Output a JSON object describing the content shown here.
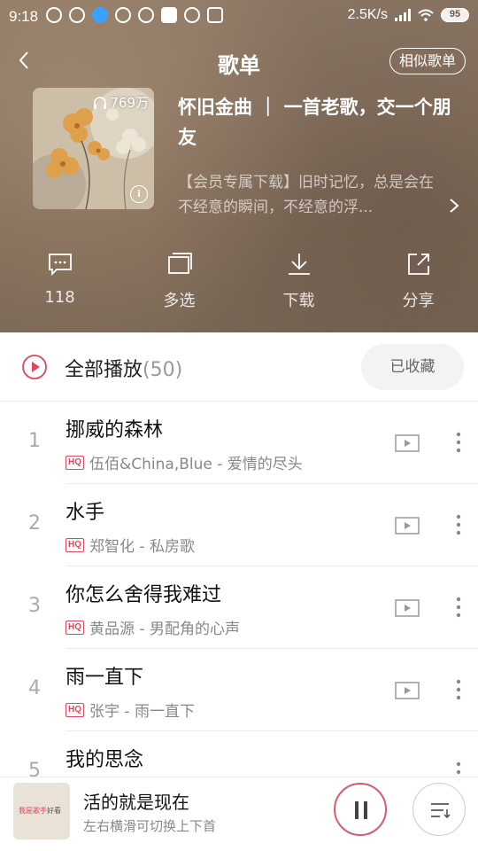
{
  "status": {
    "time": "9:18",
    "network_speed": "2.5K/s",
    "battery": "95"
  },
  "header": {
    "title": "歌单",
    "similar_button": "相似歌单"
  },
  "playlist": {
    "play_count": "769万",
    "name": "怀旧金曲 ｜ 一首老歌，交一个朋友",
    "description": "【会员专属下载】旧时记忆，总是会在不经意的瞬间，不经意的浮..."
  },
  "actions": [
    {
      "label": "118",
      "icon": "comment-icon"
    },
    {
      "label": "多选",
      "icon": "multi-select-icon"
    },
    {
      "label": "下载",
      "icon": "download-icon"
    },
    {
      "label": "分享",
      "icon": "share-icon"
    }
  ],
  "play_all": {
    "label": "全部播放",
    "count": "(50)",
    "collected_label": "已收藏"
  },
  "songs": [
    {
      "num": "1",
      "title": "挪威的森林",
      "quality": "HQ",
      "meta": "伍佰&China,Blue - 爱情的尽头"
    },
    {
      "num": "2",
      "title": "水手",
      "quality": "HQ",
      "meta": "郑智化 - 私房歌"
    },
    {
      "num": "3",
      "title": "你怎么舍得我难过",
      "quality": "HQ",
      "meta": "黄品源 - 男配角的心声"
    },
    {
      "num": "4",
      "title": "雨一直下",
      "quality": "HQ",
      "meta": "张宇 - 雨一直下"
    },
    {
      "num": "5",
      "title": "我的思念",
      "quality": "",
      "meta": ""
    }
  ],
  "player": {
    "title": "活的就是现在",
    "subtitle": "左右横滑可切换上下首",
    "cover_text_1": "我是歌手",
    "cover_text_2": "好看"
  },
  "colors": {
    "accent": "#e0475c",
    "header_bg": "#8a7462"
  }
}
